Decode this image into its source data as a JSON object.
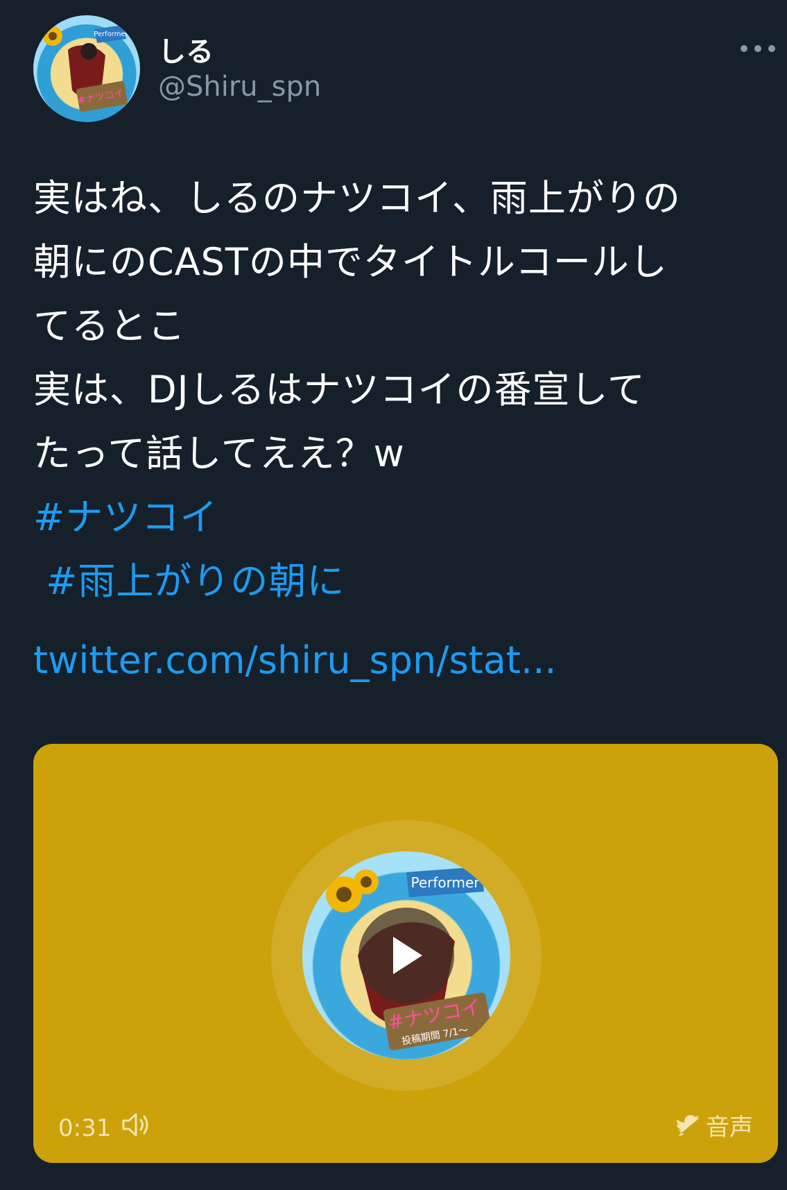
{
  "author": {
    "name": "しる",
    "handle": "@Shiru_spn"
  },
  "tweet": {
    "lines": [
      "実はね、しるのナツコイ、雨上がりの",
      "朝にのCASTの中でタイトルコールし",
      "てるとこ",
      "実は、DJしるはナツコイの番宣して",
      "たって話してええ？w"
    ],
    "hashtags": [
      "#ナツコイ",
      " #雨上がりの朝に"
    ],
    "link": "twitter.com/shiru_spn/stat..."
  },
  "media": {
    "duration": "0:31",
    "source_label": "音声",
    "background_color": "#cca10a",
    "artwork_banner": "Performer",
    "artwork_tag": "#ナツコイ",
    "artwork_period": "投稿期間 7/1～"
  },
  "icons": {
    "more": "more-horizontal-icon",
    "play": "play-icon",
    "volume": "speaker-icon",
    "bird": "twitter-bird-icon"
  },
  "colors": {
    "background": "#15202b",
    "link": "#1d9bf0",
    "muted": "#8899a6"
  }
}
